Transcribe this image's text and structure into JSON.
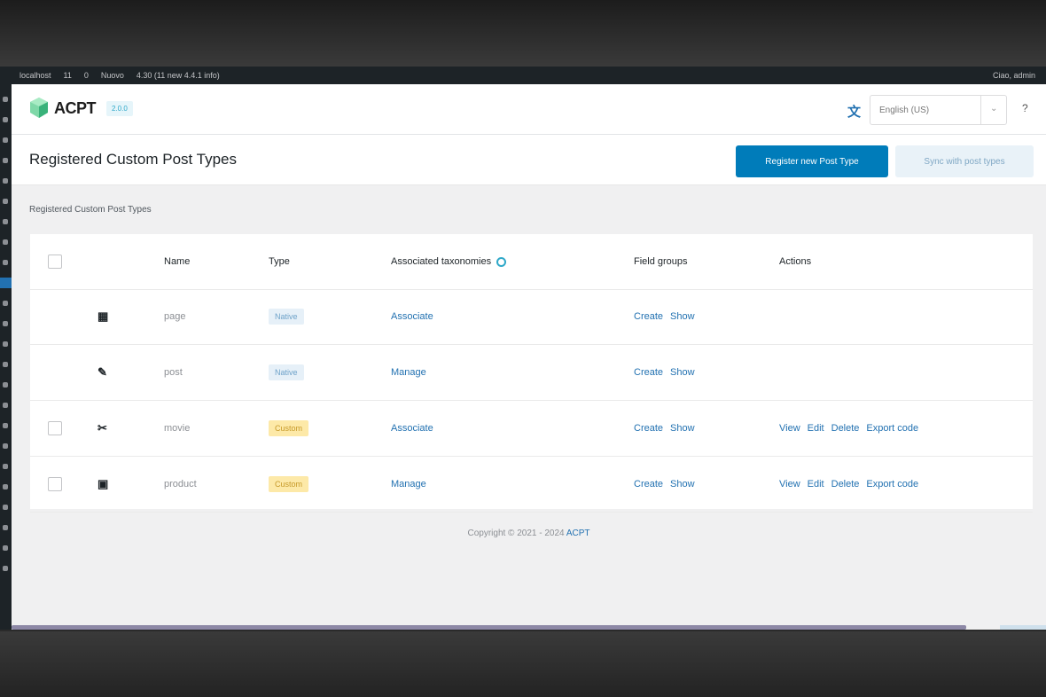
{
  "adminbar": {
    "items": [
      "localhost",
      "11",
      "0",
      "Nuovo",
      "4.30 (11 new 4.4.1 info)"
    ],
    "right": "Ciao, admin"
  },
  "header": {
    "logo_text": "ACPT",
    "badge": "2.0.0",
    "language": "English (US)",
    "help": "?"
  },
  "page": {
    "title": "Registered Custom Post Types",
    "primary_button": "Register new Post Type",
    "secondary_button": "Sync with post types",
    "breadcrumb": "Registered Custom Post Types"
  },
  "table": {
    "headers": {
      "name": "Name",
      "type": "Type",
      "taxonomies": "Associated taxonomies",
      "field_groups": "Field groups",
      "actions": "Actions"
    },
    "rows": [
      {
        "icon": "▦",
        "icon_name": "page-icon",
        "name": "page",
        "type": "Native",
        "type_kind": "native",
        "taxonomies": "Associate",
        "fg_create": "Create",
        "fg_show": "Show",
        "actions": [],
        "checkbox": false
      },
      {
        "icon": "✎",
        "icon_name": "post-icon",
        "name": "post",
        "type": "Native",
        "type_kind": "native",
        "taxonomies": "Manage",
        "fg_create": "Create",
        "fg_show": "Show",
        "actions": [],
        "checkbox": false
      },
      {
        "icon": "✂",
        "icon_name": "movie-icon",
        "name": "movie",
        "type": "Custom",
        "type_kind": "custom",
        "taxonomies": "Associate",
        "fg_create": "Create",
        "fg_show": "Show",
        "actions": [
          "View",
          "Edit",
          "Delete",
          "Export code"
        ],
        "checkbox": true
      },
      {
        "icon": "▣",
        "icon_name": "product-icon",
        "name": "product",
        "type": "Custom",
        "type_kind": "custom",
        "taxonomies": "Manage",
        "fg_create": "Create",
        "fg_show": "Show",
        "actions": [
          "View",
          "Edit",
          "Delete",
          "Export code"
        ],
        "checkbox": true
      }
    ]
  },
  "footer": {
    "copyright": "Copyright © 2021 - 2024",
    "brand": "ACPT"
  },
  "colors": {
    "primary": "#007cba",
    "link": "#2271b1",
    "custom_tag": "#fde9a8",
    "native_tag": "#e6f0f8"
  }
}
